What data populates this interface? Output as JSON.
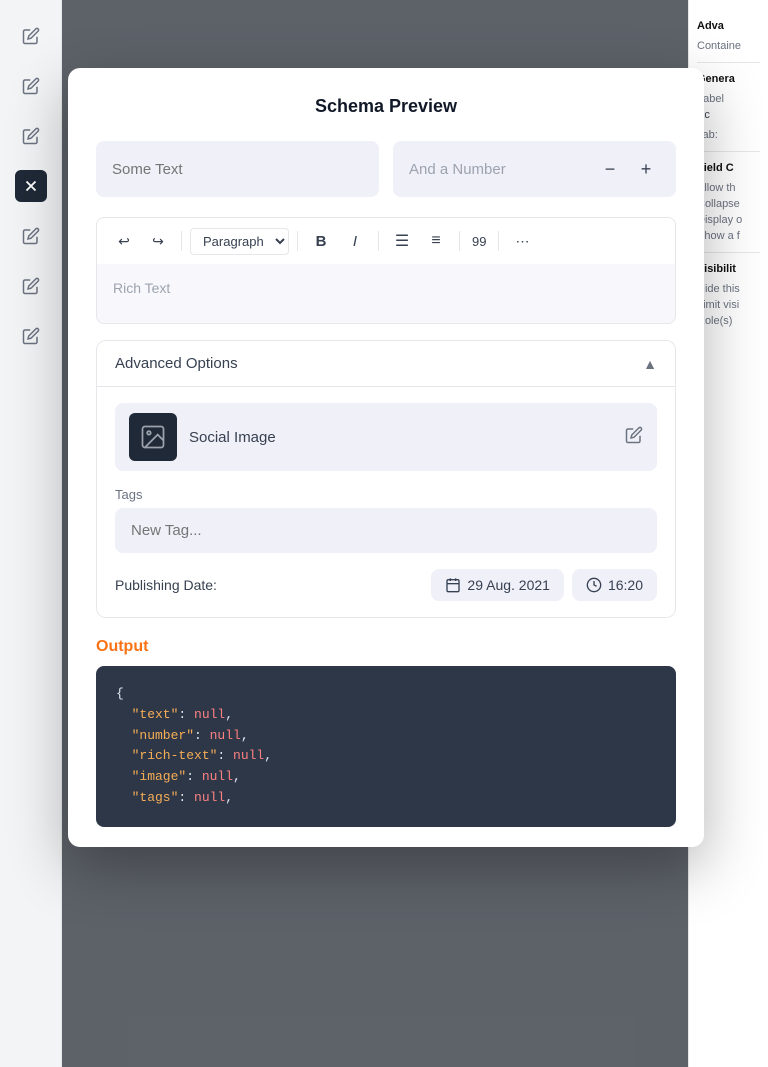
{
  "modal": {
    "title": "Schema Preview",
    "fields": {
      "text_placeholder": "Some Text",
      "number_placeholder": "And a Number"
    },
    "toolbar": {
      "paragraph_label": "Paragraph",
      "bold_label": "B",
      "italic_label": "I",
      "unordered_list_label": "≡",
      "ordered_list_label": "≡",
      "number_label": "99",
      "more_label": "⋯"
    },
    "rich_text_placeholder": "Rich Text",
    "advanced_options": {
      "label": "Advanced Options",
      "social_image_label": "Social Image",
      "tags_label": "Tags",
      "tags_placeholder": "New Tag...",
      "publishing_date_label": "Publishing Date:",
      "date_value": "29 Aug. 2021",
      "time_value": "16:20"
    },
    "output": {
      "label": "Output",
      "code_lines": [
        "{",
        "  \"text\": null,",
        "  \"number\": null,",
        "  \"rich-text\": null,",
        "  \"image\": null,",
        "  \"tags\": null,"
      ]
    }
  },
  "left_sidebar": {
    "icons": [
      "pencil",
      "pencil",
      "pencil",
      "close",
      "pencil",
      "pencil",
      "pencil"
    ]
  },
  "right_sidebar": {
    "adva_title": "Adva",
    "container_label": "Containe",
    "general_title": "Genera",
    "label_text": "Label",
    "ac_text": "Ac",
    "tab_label": "Tab:",
    "field_c_title": "Field C",
    "allow_text": "Allow th",
    "collapse_text": "Collapse",
    "display_text": "Display o",
    "show_text": "Show a f",
    "visibility_title": "Visibilit",
    "hide_text": "Hide this",
    "limit_text": "Limit visi",
    "roles_text": "Role(s)"
  }
}
